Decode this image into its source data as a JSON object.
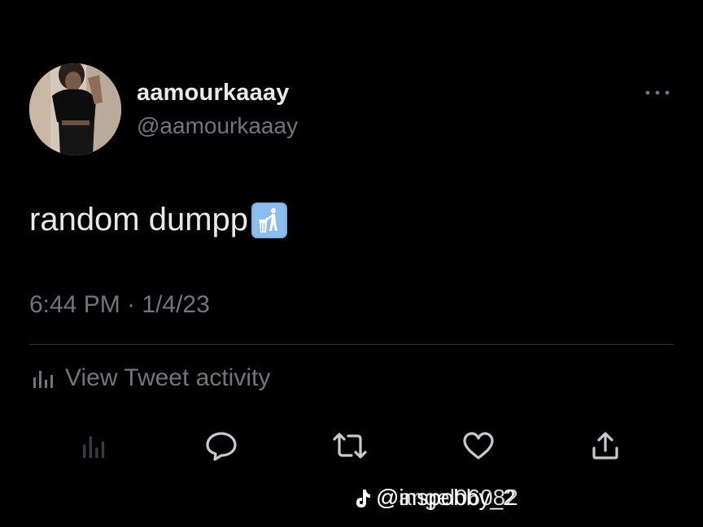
{
  "author": {
    "display_name": "aamourkaaay",
    "handle": "@aamourkaaay"
  },
  "tweet": {
    "text": "random dumpp",
    "emoji": "wastebasket-emoji",
    "timestamp": "6:44 PM · 1/4/23"
  },
  "activity": {
    "label": "View Tweet activity",
    "icon": "bar-chart-icon"
  },
  "actions": [
    {
      "name": "analytics",
      "icon": "bar-chart-icon"
    },
    {
      "name": "reply",
      "icon": "speech-bubble-icon"
    },
    {
      "name": "retweet",
      "icon": "retweet-icon"
    },
    {
      "name": "like",
      "icon": "heart-icon"
    },
    {
      "name": "share",
      "icon": "share-icon"
    }
  ],
  "watermark": {
    "text_primary": "@inspobby_2",
    "text_secondary": "@angel06082"
  },
  "colors": {
    "background": "#000000",
    "primary_text": "#e7e9ea",
    "secondary_text": "#71767b",
    "divider": "#2f3336",
    "emoji_blue": "#7fb2e5"
  }
}
